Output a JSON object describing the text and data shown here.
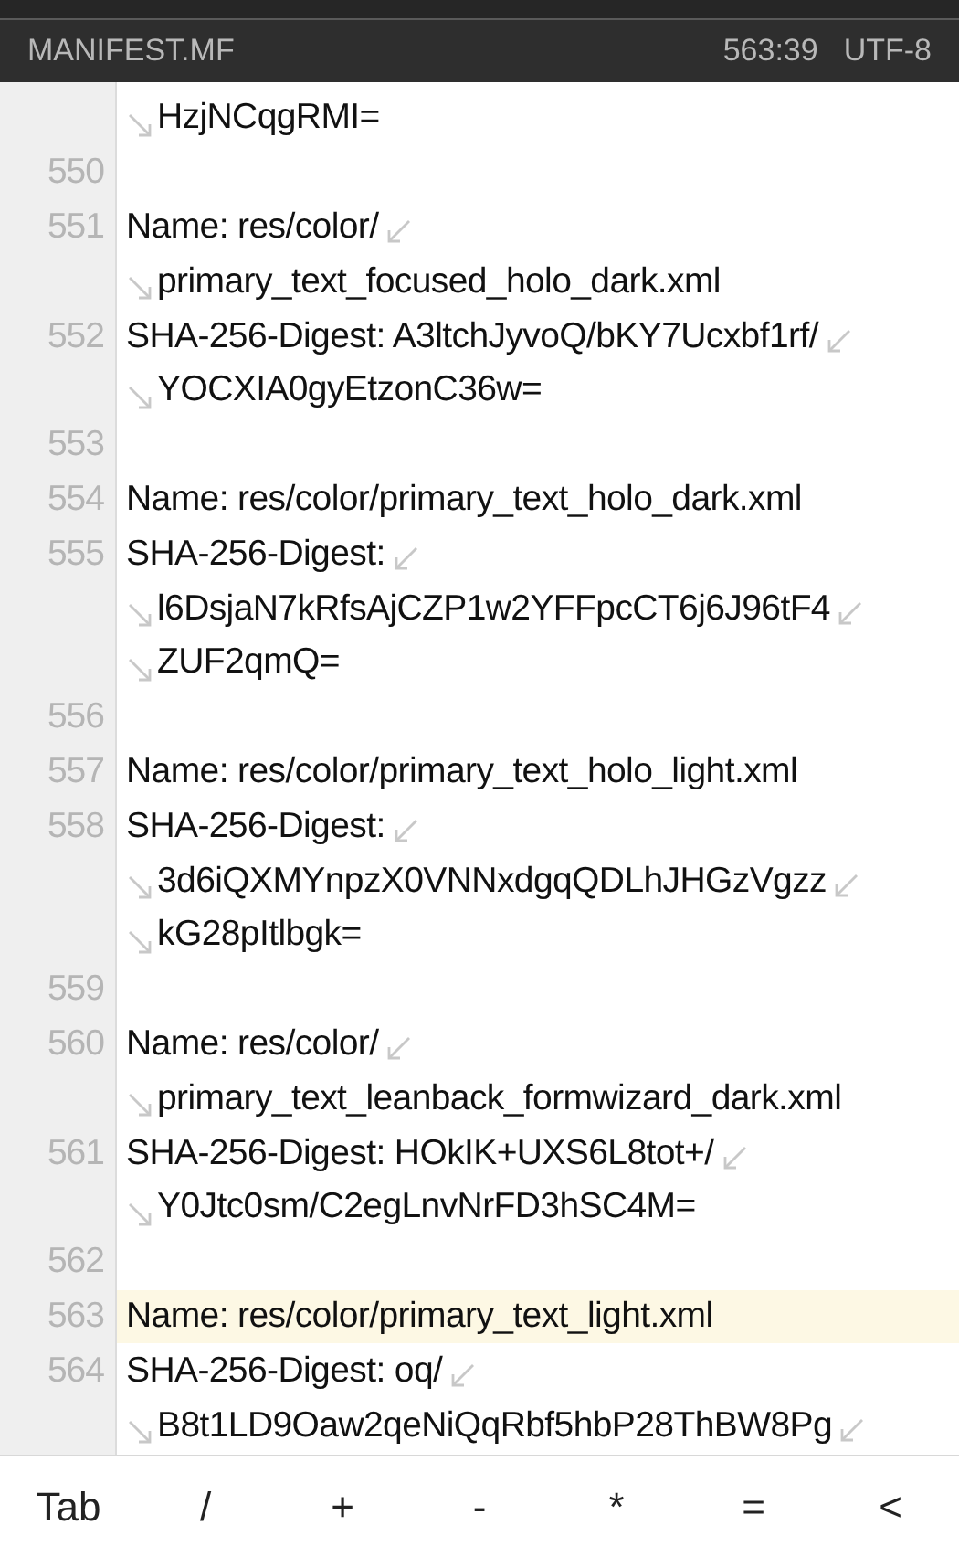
{
  "header": {
    "file_name": "MANIFEST.MF",
    "cursor_position": "563:39",
    "encoding": "UTF-8"
  },
  "lines": [
    {
      "continued": true,
      "continues": false,
      "current": false,
      "rows": [
        "HzjNCqgRMI="
      ]
    },
    {
      "number": "550",
      "continued": false,
      "continues": false,
      "current": false
    },
    {
      "number": "551",
      "continued": false,
      "continues": false,
      "current": false,
      "rows": [
        "Name: res/color/",
        "primary_text_focused_holo_dark.xml"
      ]
    },
    {
      "number": "552",
      "continued": false,
      "continues": false,
      "current": false,
      "rows": [
        "SHA-256-Digest: A3ltchJyvoQ/bKY7Ucxbf1rf/",
        "YOCXIA0gyEtzonC36w="
      ]
    },
    {
      "number": "553",
      "continued": false,
      "continues": false,
      "current": false
    },
    {
      "number": "554",
      "continued": false,
      "continues": false,
      "current": false,
      "rows": [
        "Name: res/color/primary_text_holo_dark.xml"
      ]
    },
    {
      "number": "555",
      "continued": false,
      "continues": false,
      "current": false,
      "rows": [
        "SHA-256-Digest:",
        "l6DsjaN7kRfsAjCZP1w2YFFpcCT6j6J96tF4",
        "ZUF2qmQ="
      ]
    },
    {
      "number": "556",
      "continued": false,
      "continues": false,
      "current": false
    },
    {
      "number": "557",
      "continued": false,
      "continues": false,
      "current": false,
      "rows": [
        "Name: res/color/primary_text_holo_light.xml"
      ]
    },
    {
      "number": "558",
      "continued": false,
      "continues": false,
      "current": false,
      "rows": [
        "SHA-256-Digest:",
        "3d6iQXMYnpzX0VNNxdgqQDLhJHGzVgzz",
        "kG28pItlbgk="
      ]
    },
    {
      "number": "559",
      "continued": false,
      "continues": false,
      "current": false
    },
    {
      "number": "560",
      "continued": false,
      "continues": false,
      "current": false,
      "rows": [
        "Name: res/color/",
        "primary_text_leanback_formwizard_dark.xml"
      ]
    },
    {
      "number": "561",
      "continued": false,
      "continues": false,
      "current": false,
      "rows": [
        "SHA-256-Digest: HOkIK+UXS6L8tot+/",
        "Y0Jtc0sm/C2egLnvNrFD3hSC4M="
      ]
    },
    {
      "number": "562",
      "continued": false,
      "continues": false,
      "current": false
    },
    {
      "number": "563",
      "continued": false,
      "continues": false,
      "current": true,
      "rows": [
        "Name: res/color/primary_text_light.xml"
      ]
    },
    {
      "number": "564",
      "continued": false,
      "continues": true,
      "current": false,
      "rows": [
        "SHA-256-Digest: oq/",
        "B8t1LD9Oaw2qeNiQqRbf5hbP28ThBW8Pg"
      ]
    }
  ],
  "keys": [
    "Tab",
    "/",
    "+",
    "-",
    "*",
    "=",
    "<"
  ]
}
